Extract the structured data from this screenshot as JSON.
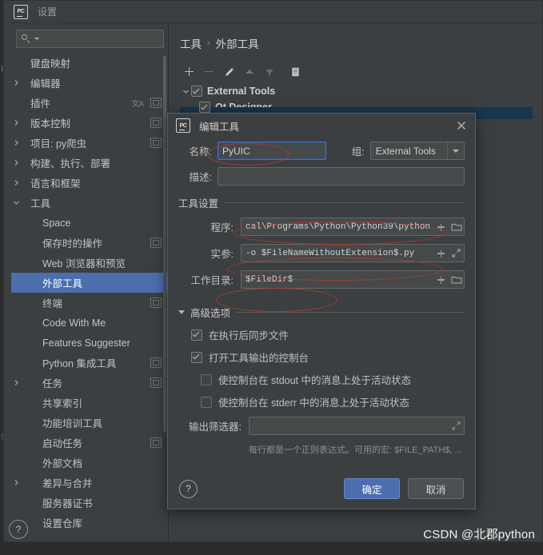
{
  "window": {
    "title": "设置",
    "logo_text": "PC"
  },
  "search": {
    "placeholder": "",
    "value": "",
    "icon": "search-icon"
  },
  "nav": {
    "items": [
      {
        "label": "键盘映射",
        "arrow": "",
        "badge": false,
        "selected": false
      },
      {
        "label": "编辑器",
        "arrow": "right",
        "badge": false,
        "selected": false
      },
      {
        "label": "插件",
        "arrow": "",
        "badge": true,
        "lang": "文A",
        "selected": false
      },
      {
        "label": "版本控制",
        "arrow": "right",
        "badge": true,
        "selected": false
      },
      {
        "label": "项目: py爬虫",
        "arrow": "right",
        "badge": true,
        "selected": false
      },
      {
        "label": "构建、执行、部署",
        "arrow": "right",
        "badge": false,
        "selected": false
      },
      {
        "label": "语言和框架",
        "arrow": "right",
        "badge": false,
        "selected": false
      },
      {
        "label": "工具",
        "arrow": "down",
        "badge": false,
        "selected": false
      },
      {
        "label": "Space",
        "arrow": "",
        "badge": false,
        "selected": false,
        "indent": true
      },
      {
        "label": "保存时的操作",
        "arrow": "",
        "badge": true,
        "selected": false,
        "indent": true
      },
      {
        "label": "Web 浏览器和预览",
        "arrow": "",
        "badge": false,
        "selected": false,
        "indent": true
      },
      {
        "label": "外部工具",
        "arrow": "",
        "badge": false,
        "selected": true,
        "indent": true
      },
      {
        "label": "终端",
        "arrow": "",
        "badge": true,
        "selected": false,
        "indent": true
      },
      {
        "label": "Code With Me",
        "arrow": "",
        "badge": false,
        "selected": false,
        "indent": true
      },
      {
        "label": "Features Suggester",
        "arrow": "",
        "badge": false,
        "selected": false,
        "indent": true
      },
      {
        "label": "Python 集成工具",
        "arrow": "",
        "badge": true,
        "selected": false,
        "indent": true
      },
      {
        "label": "任务",
        "arrow": "right",
        "badge": true,
        "selected": false,
        "indent": true
      },
      {
        "label": "共享索引",
        "arrow": "",
        "badge": false,
        "selected": false,
        "indent": true
      },
      {
        "label": "功能培训工具",
        "arrow": "",
        "badge": false,
        "selected": false,
        "indent": true
      },
      {
        "label": "启动任务",
        "arrow": "",
        "badge": true,
        "selected": false,
        "indent": true
      },
      {
        "label": "外部文档",
        "arrow": "",
        "badge": false,
        "selected": false,
        "indent": true
      },
      {
        "label": "差异与合并",
        "arrow": "right",
        "badge": false,
        "selected": false,
        "indent": true
      },
      {
        "label": "服务器证书",
        "arrow": "",
        "badge": false,
        "selected": false,
        "indent": true
      },
      {
        "label": "设置仓库",
        "arrow": "",
        "badge": false,
        "selected": false,
        "indent": true
      }
    ]
  },
  "breadcrumb": {
    "root": "工具",
    "separator": "›",
    "current": "外部工具"
  },
  "toolbar": {
    "add": "add-icon",
    "remove": "remove-icon",
    "edit": "pencil-icon",
    "move_up": "arrow-up-icon",
    "filter": "filter-icon",
    "copy": "copy-icon"
  },
  "tree": {
    "root": {
      "label": "External Tools",
      "checked": true
    },
    "child": {
      "label": "Qt Designer",
      "checked": true
    }
  },
  "dialog": {
    "title": "编辑工具",
    "logo_text": "PC",
    "close": "close-icon",
    "name_label": "名称:",
    "name_value": "PyUIC",
    "group_label": "组:",
    "group_value": "External Tools",
    "desc_label": "描述:",
    "desc_value": "",
    "tool_settings_title": "工具设置",
    "program_label": "程序:",
    "program_value": "cal\\Programs\\Python\\Python39\\python",
    "arguments_label": "实参:",
    "arguments_value": "-o $FileNameWithoutExtension$.py",
    "workdir_label": "工作目录:",
    "workdir_value": "$FileDir$",
    "advanced_title": "高级选项",
    "chk_sync_label": "在执行后同步文件",
    "chk_sync_checked": true,
    "chk_console_label": "打开工具输出的控制台",
    "chk_console_checked": true,
    "chk_stdout_label": "使控制台在 stdout 中的消息上处于活动状态",
    "chk_stdout_checked": false,
    "chk_stderr_label": "使控制台在 stderr 中的消息上处于活动状态",
    "chk_stderr_checked": false,
    "output_filter_label": "输出筛选器:",
    "output_filter_value": "",
    "hint": "每行都是一个正则表达式。可用的宏: $FILE_PATH$, ...",
    "help": "?",
    "ok_label": "确定",
    "cancel_label": "取消"
  },
  "colors": {
    "accent": "#4b6eaf",
    "panel": "#3c3f41",
    "field": "#45494a",
    "annotation": "#c0392b",
    "selection": "#4b6eaf"
  },
  "watermark": {
    "text": "CSDN @北郡python"
  },
  "editor": {
    "left_fragment_1": "p",
    "left_fragment_2": "g"
  }
}
